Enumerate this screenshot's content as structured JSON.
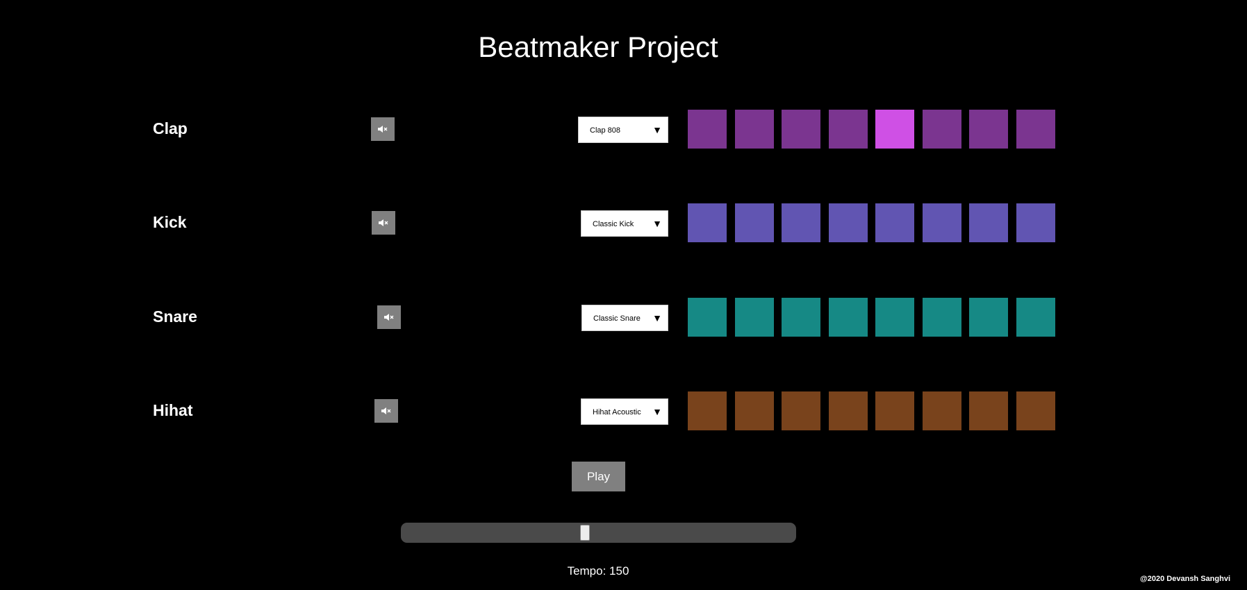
{
  "title": "Beatmaker Project",
  "tracks": [
    {
      "name": "Clap",
      "sound": "Clap 808",
      "mute_icon": "mute-speaker-icon",
      "pad_color": "#7b3590",
      "active_color": "#cf50e5",
      "pads": [
        false,
        false,
        false,
        false,
        true,
        false,
        false,
        false
      ]
    },
    {
      "name": "Kick",
      "sound": "Classic Kick",
      "mute_icon": "mute-speaker-icon",
      "pad_color": "#6155b2",
      "active_color": "#8a7cf0",
      "pads": [
        false,
        false,
        false,
        false,
        false,
        false,
        false,
        false
      ]
    },
    {
      "name": "Snare",
      "sound": "Classic Snare",
      "mute_icon": "mute-speaker-icon",
      "pad_color": "#168985",
      "active_color": "#2cd6cf",
      "pads": [
        false,
        false,
        false,
        false,
        false,
        false,
        false,
        false
      ]
    },
    {
      "name": "Hihat",
      "sound": "Hihat Acoustic",
      "mute_icon": "mute-speaker-icon",
      "pad_color": "#79431c",
      "active_color": "#c46d2e",
      "pads": [
        false,
        false,
        false,
        false,
        false,
        false,
        false,
        false
      ]
    }
  ],
  "play_label": "Play",
  "tempo": {
    "label": "Tempo:",
    "value": "150",
    "min": 20,
    "max": 300
  },
  "footer": "@2020 Devansh Sanghvi",
  "colors": {
    "background": "#000000",
    "button": "#808080",
    "slider_track": "#4a4a4a"
  }
}
